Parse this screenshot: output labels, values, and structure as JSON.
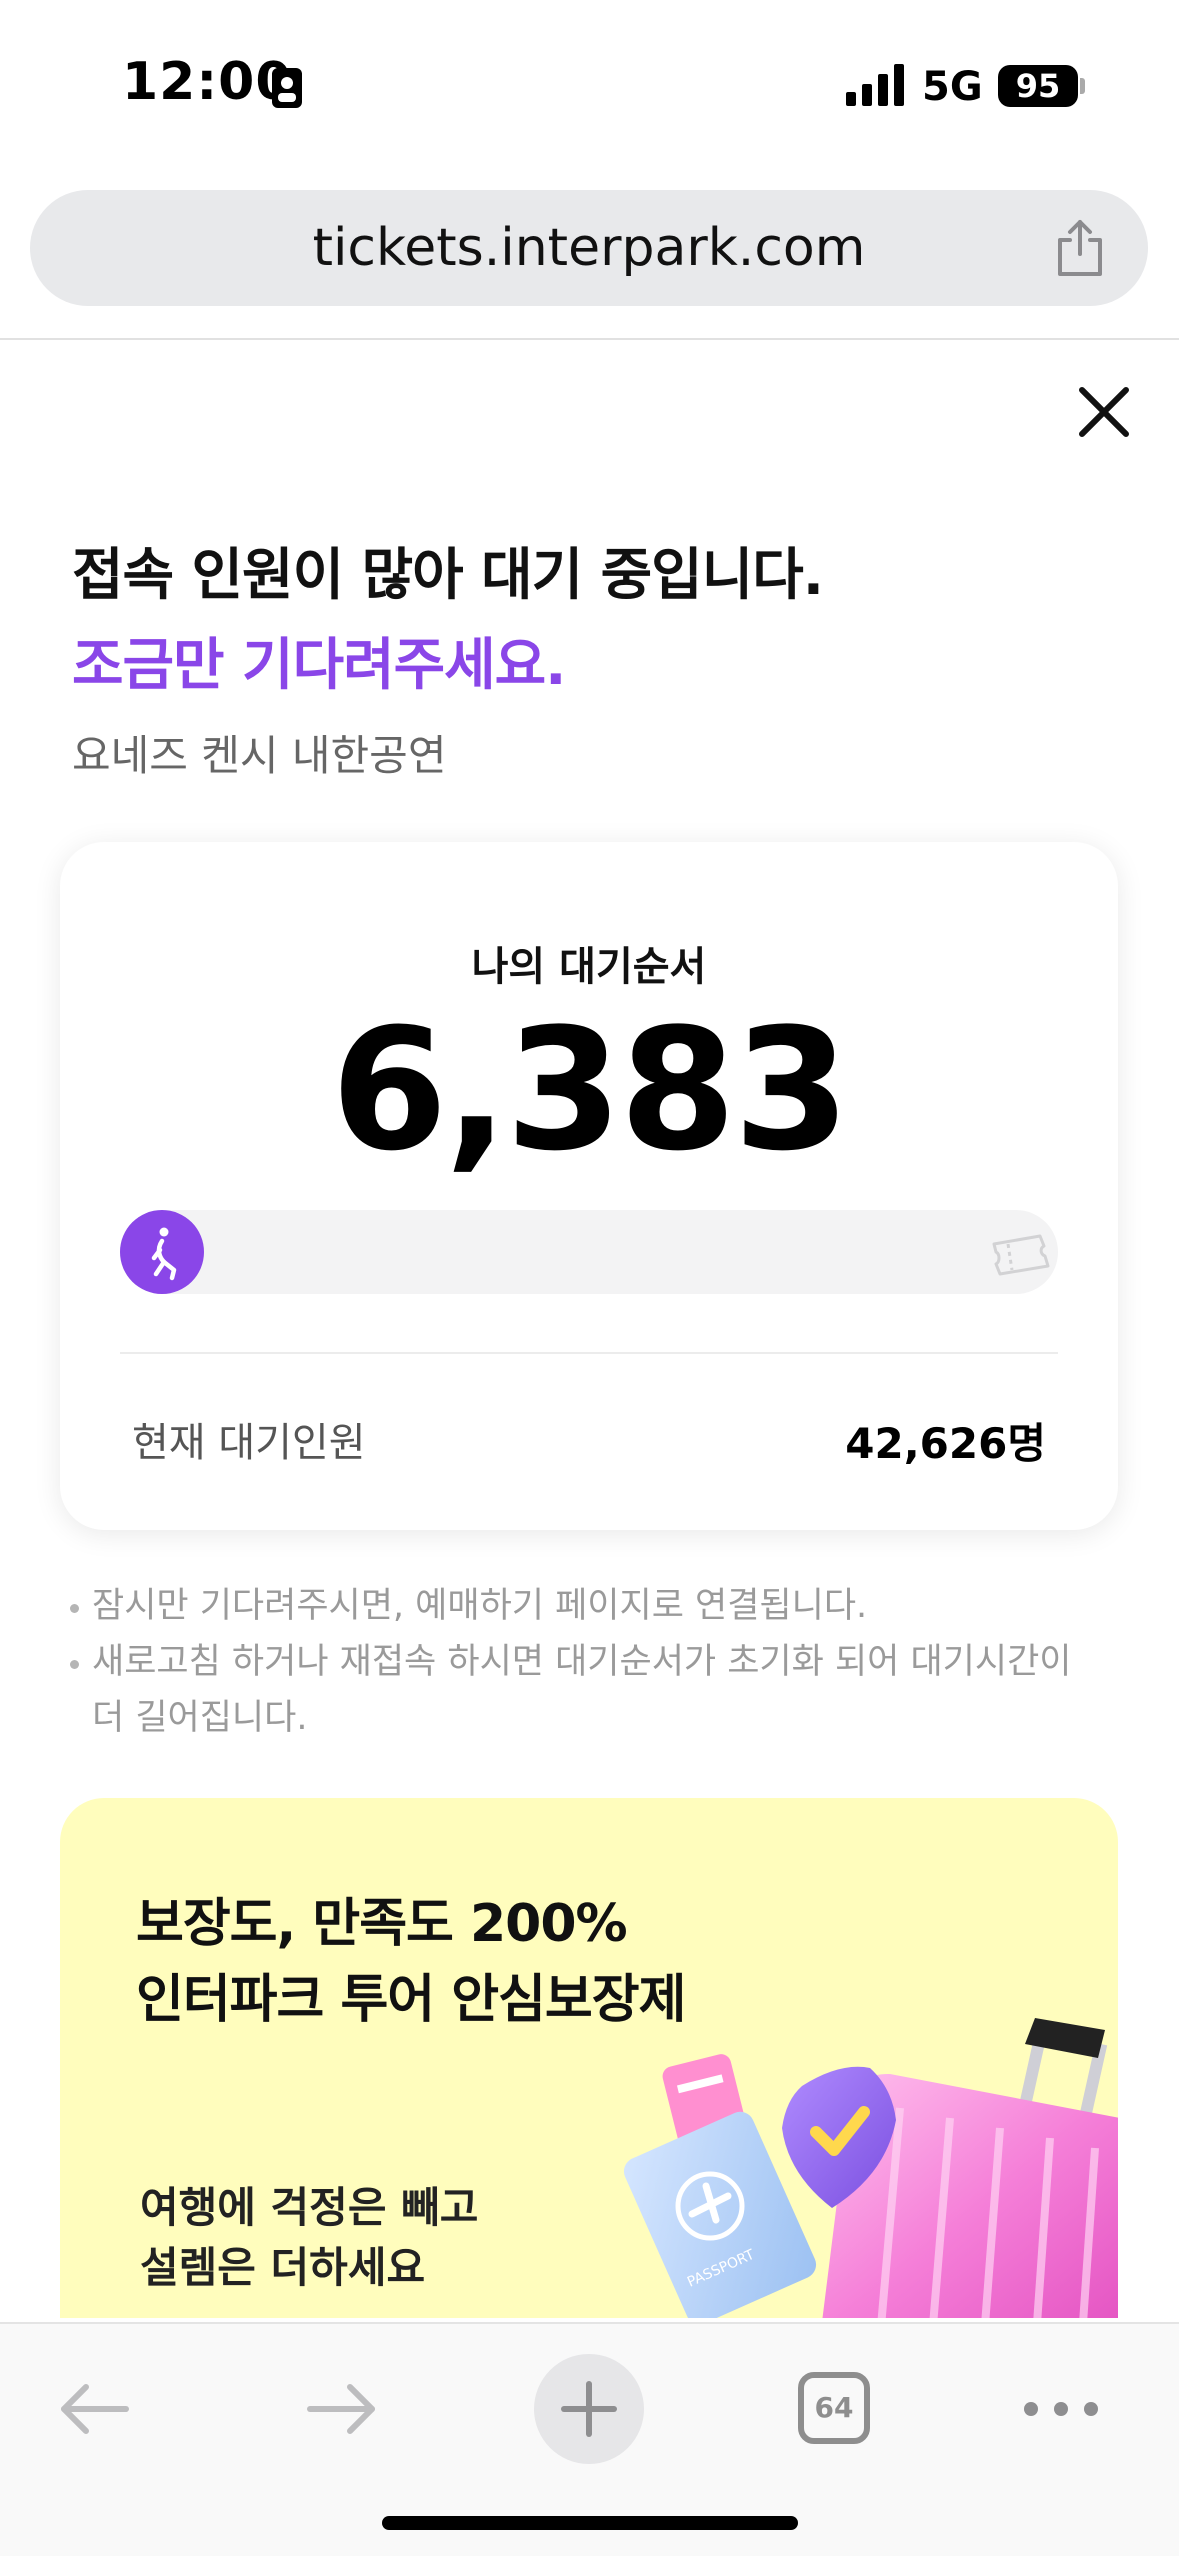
{
  "status_bar": {
    "time": "12:00",
    "network": "5G",
    "battery": "95"
  },
  "browser": {
    "url": "tickets.interpark.com",
    "tab_count": "64"
  },
  "queue_page": {
    "headline": "접속 인원이 많아 대기 중입니다.",
    "subheadline": "조금만 기다려주세요.",
    "event_name": "요네즈 켄시 내한공연",
    "my_position_label": "나의 대기순서",
    "my_position": "6,383",
    "progress_fraction": 0,
    "total_waiting_label": "현재 대기인원",
    "total_waiting_value": "42,626명",
    "accent_color": "#8a46e8",
    "notices": [
      "잠시만 기다려주시면, 예매하기 페이지로 연결됩니다.",
      "새로고침 하거나 재접속 하시면 대기순서가 초기화 되어 대기시간이 더 길어집니다."
    ]
  },
  "banner": {
    "title_line1": "보장도, 만족도 200%",
    "title_line2": "인터파크 투어 안심보장제",
    "subtitle_line1": "여행에 걱정은 빼고",
    "subtitle_line2": "설렘은 더하세요",
    "passport_text": "PASSPORT",
    "background_color": "#fffdbd"
  },
  "icons": {
    "share": "share-icon",
    "close": "close-icon",
    "runner": "runner-icon",
    "ticket": "ticket-icon",
    "back": "back-arrow-icon",
    "forward": "forward-arrow-icon",
    "new_tab": "plus-icon",
    "tabs": "tabs-icon",
    "more": "more-icon"
  }
}
